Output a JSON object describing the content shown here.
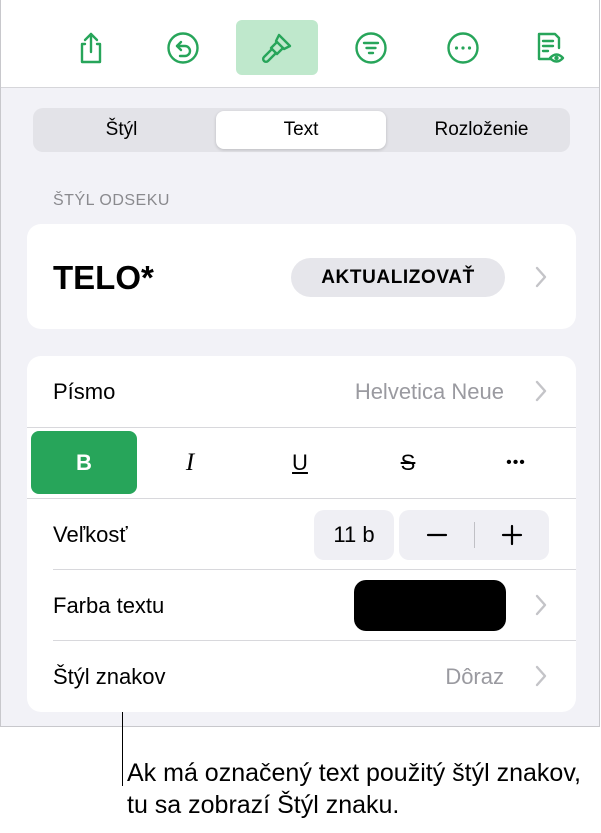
{
  "colors": {
    "accent": "#27a55a",
    "accent_light": "#bfe8cc",
    "secondary_text": "#9a9aa0",
    "swatch": "#000000"
  },
  "toolbar": {
    "items": [
      {
        "icon": "share-icon"
      },
      {
        "icon": "undo-icon"
      },
      {
        "icon": "format-brush-icon",
        "active": true
      },
      {
        "icon": "filter-icon"
      },
      {
        "icon": "more-icon"
      },
      {
        "icon": "document-preview-icon"
      }
    ]
  },
  "tabs": {
    "style": "Štýl",
    "text": "Text",
    "layout": "Rozloženie"
  },
  "paragraph_style": {
    "section_label": "ŠTÝL ODSEKU",
    "name": "TELO*",
    "update_label": "AKTUALIZOVAŤ"
  },
  "font": {
    "label": "Písmo",
    "value": "Helvetica Neue"
  },
  "format_buttons": {
    "bold": "B",
    "italic": "I",
    "underline": "U",
    "strike": "S",
    "more": "•••"
  },
  "size": {
    "label": "Veľkosť",
    "value": "11 b",
    "minus": "−",
    "plus": "+"
  },
  "text_color": {
    "label": "Farba textu"
  },
  "char_style": {
    "label": "Štýl znakov",
    "value": "Dôraz"
  },
  "callout": {
    "text": "Ak má označený text použitý štýl znakov, tu sa zobrazí Štýl znaku."
  }
}
